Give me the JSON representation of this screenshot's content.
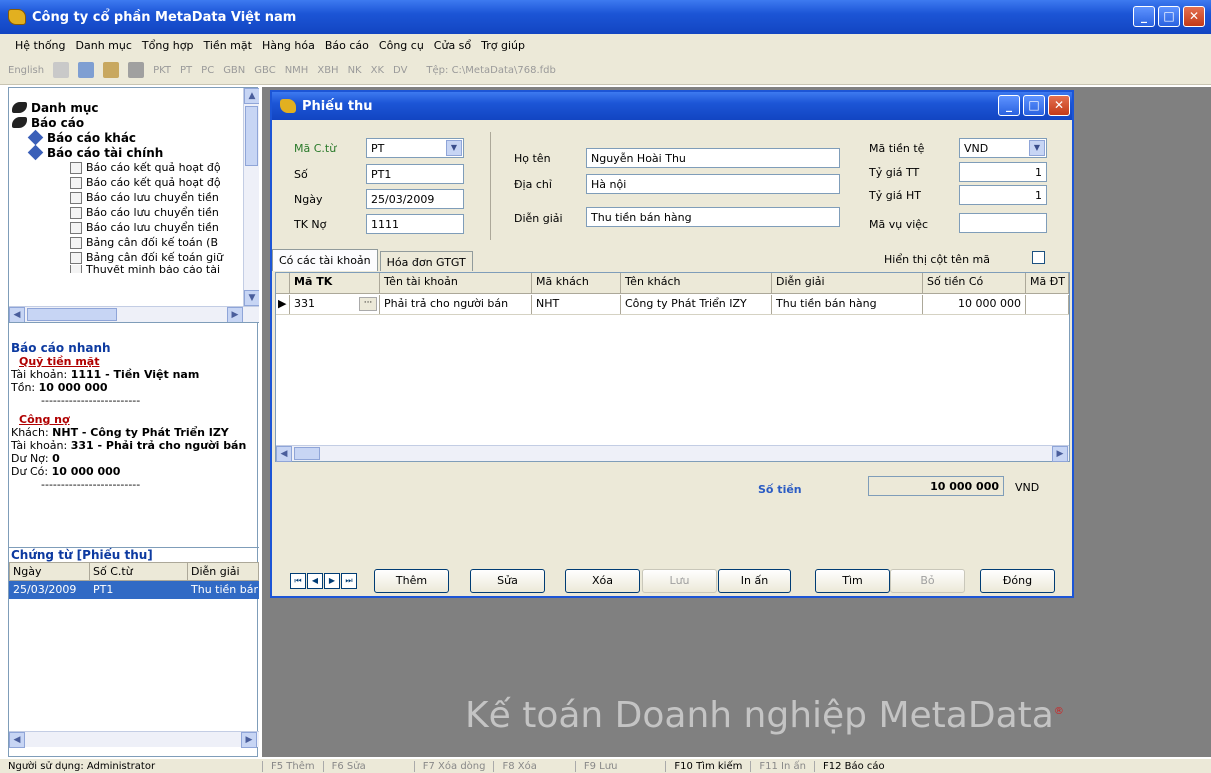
{
  "app": {
    "title": "Công ty cổ phần MetaData Việt nam"
  },
  "menu": [
    "Hệ thống",
    "Danh mục",
    "Tổng hợp",
    "Tiền mặt",
    "Hàng hóa",
    "Báo cáo",
    "Công cụ",
    "Cửa sổ",
    "Trợ giúp"
  ],
  "toolbar": {
    "lang": "English",
    "buttons": [
      "PKT",
      "PT",
      "PC",
      "GBN",
      "GBC",
      "NMH",
      "XBH",
      "NK",
      "XK",
      "DV"
    ],
    "file": "Tệp: C:\\MetaData\\768.fdb"
  },
  "tree": {
    "root1": "Danh mục",
    "root2": "Báo cáo",
    "group1": "Báo cáo khác",
    "group2": "Báo cáo tài chính",
    "items": [
      "Báo cáo kết quả hoạt độ",
      "Báo cáo kết quả hoạt độ",
      "Báo cáo lưu chuyển tiền",
      "Báo cáo lưu chuyển tiền",
      "Báo cáo lưu chuyển tiền",
      "Bảng cân đối kế toán (B",
      "Bảng cân đối kế toán giữ",
      "Thuyết minh báo cáo tài"
    ]
  },
  "quick": {
    "title": "Báo cáo nhanh",
    "cash_title": "Quỹ tiền mặt",
    "cash_acct_label": "Tài khoản: ",
    "cash_acct": "1111 - Tiền Việt nam",
    "cash_bal_label": "Tồn: ",
    "cash_bal": "10 000 000",
    "dashes": "-------------------------",
    "debt_title": "Công nợ",
    "cust_label": "Khách: ",
    "cust": "NHT - Công ty Phát Triển IZY",
    "debt_acct_label": "Tài khoản: ",
    "debt_acct": "331 - Phải trả cho người bán",
    "no_label": "Dư Nợ: ",
    "no": "0",
    "co_label": "Dư Có: ",
    "co": "10 000 000"
  },
  "voucher_list": {
    "title": "Chứng từ [Phiếu thu]",
    "cols": [
      "Ngày",
      "Số C.từ",
      "Diễn giải"
    ],
    "row": [
      "25/03/2009",
      "PT1",
      "Thu tiền bán hàng"
    ]
  },
  "dialog": {
    "title": "Phiếu thu",
    "ma_ct_label": "Mã C.từ",
    "ma_ct": "PT",
    "so_label": "Số",
    "so": "PT1",
    "ngay_label": "Ngày",
    "ngay": "25/03/2009",
    "tkno_label": "TK Nợ",
    "tkno": "1111",
    "hoten_label": "Họ tên",
    "hoten": "Nguyễn Hoài Thu",
    "diachi_label": "Địa chỉ",
    "diachi": "Hà nội",
    "diengiai_label": "Diễn giải",
    "diengiai": "Thu tiền bán hàng",
    "tiente_label": "Mã tiền tệ",
    "tiente": "VND",
    "tygiatt_label": "Tỷ giá TT",
    "tygiatt": "1",
    "tygiaht_label": "Tỷ giá HT",
    "tygiaht": "1",
    "mavuviec_label": "Mã vụ việc",
    "mavuviec": "",
    "tab1": "Có các tài khoản",
    "tab2": "Hóa đơn GTGT",
    "show_code_label": "Hiển thị cột tên mã",
    "grid_cols": [
      "Mã TK",
      "Tên tài khoản",
      "Mã khách",
      "Tên khách",
      "Diễn giải",
      "Số tiền Có",
      "Mã ĐT"
    ],
    "grid_row": [
      "331",
      "Phải trả cho người bán",
      "NHT",
      "Công ty Phát Triển IZY",
      "Thu tiền bán hàng",
      "10 000 000",
      ""
    ],
    "sotien_label": "Số tiền",
    "sotien": "10 000 000",
    "currency": "VND",
    "buttons": {
      "them": "Thêm",
      "sua": "Sửa",
      "xoa": "Xóa",
      "luu": "Lưu",
      "in": "In ấn",
      "tim": "Tìm",
      "bo": "Bỏ",
      "dong": "Đóng"
    }
  },
  "watermark": "Kế toán Doanh nghiệp MetaData",
  "status": {
    "user": "Người sử dụng: Administrator",
    "f5": "F5 Thêm",
    "f6": "F6 Sửa",
    "f7": "F7 Xóa dòng",
    "f8": "F8 Xóa",
    "f9": "F9 Lưu",
    "f10": "F10 Tìm kiếm",
    "f11": "F11 In ấn",
    "f12": "F12 Báo cáo"
  }
}
